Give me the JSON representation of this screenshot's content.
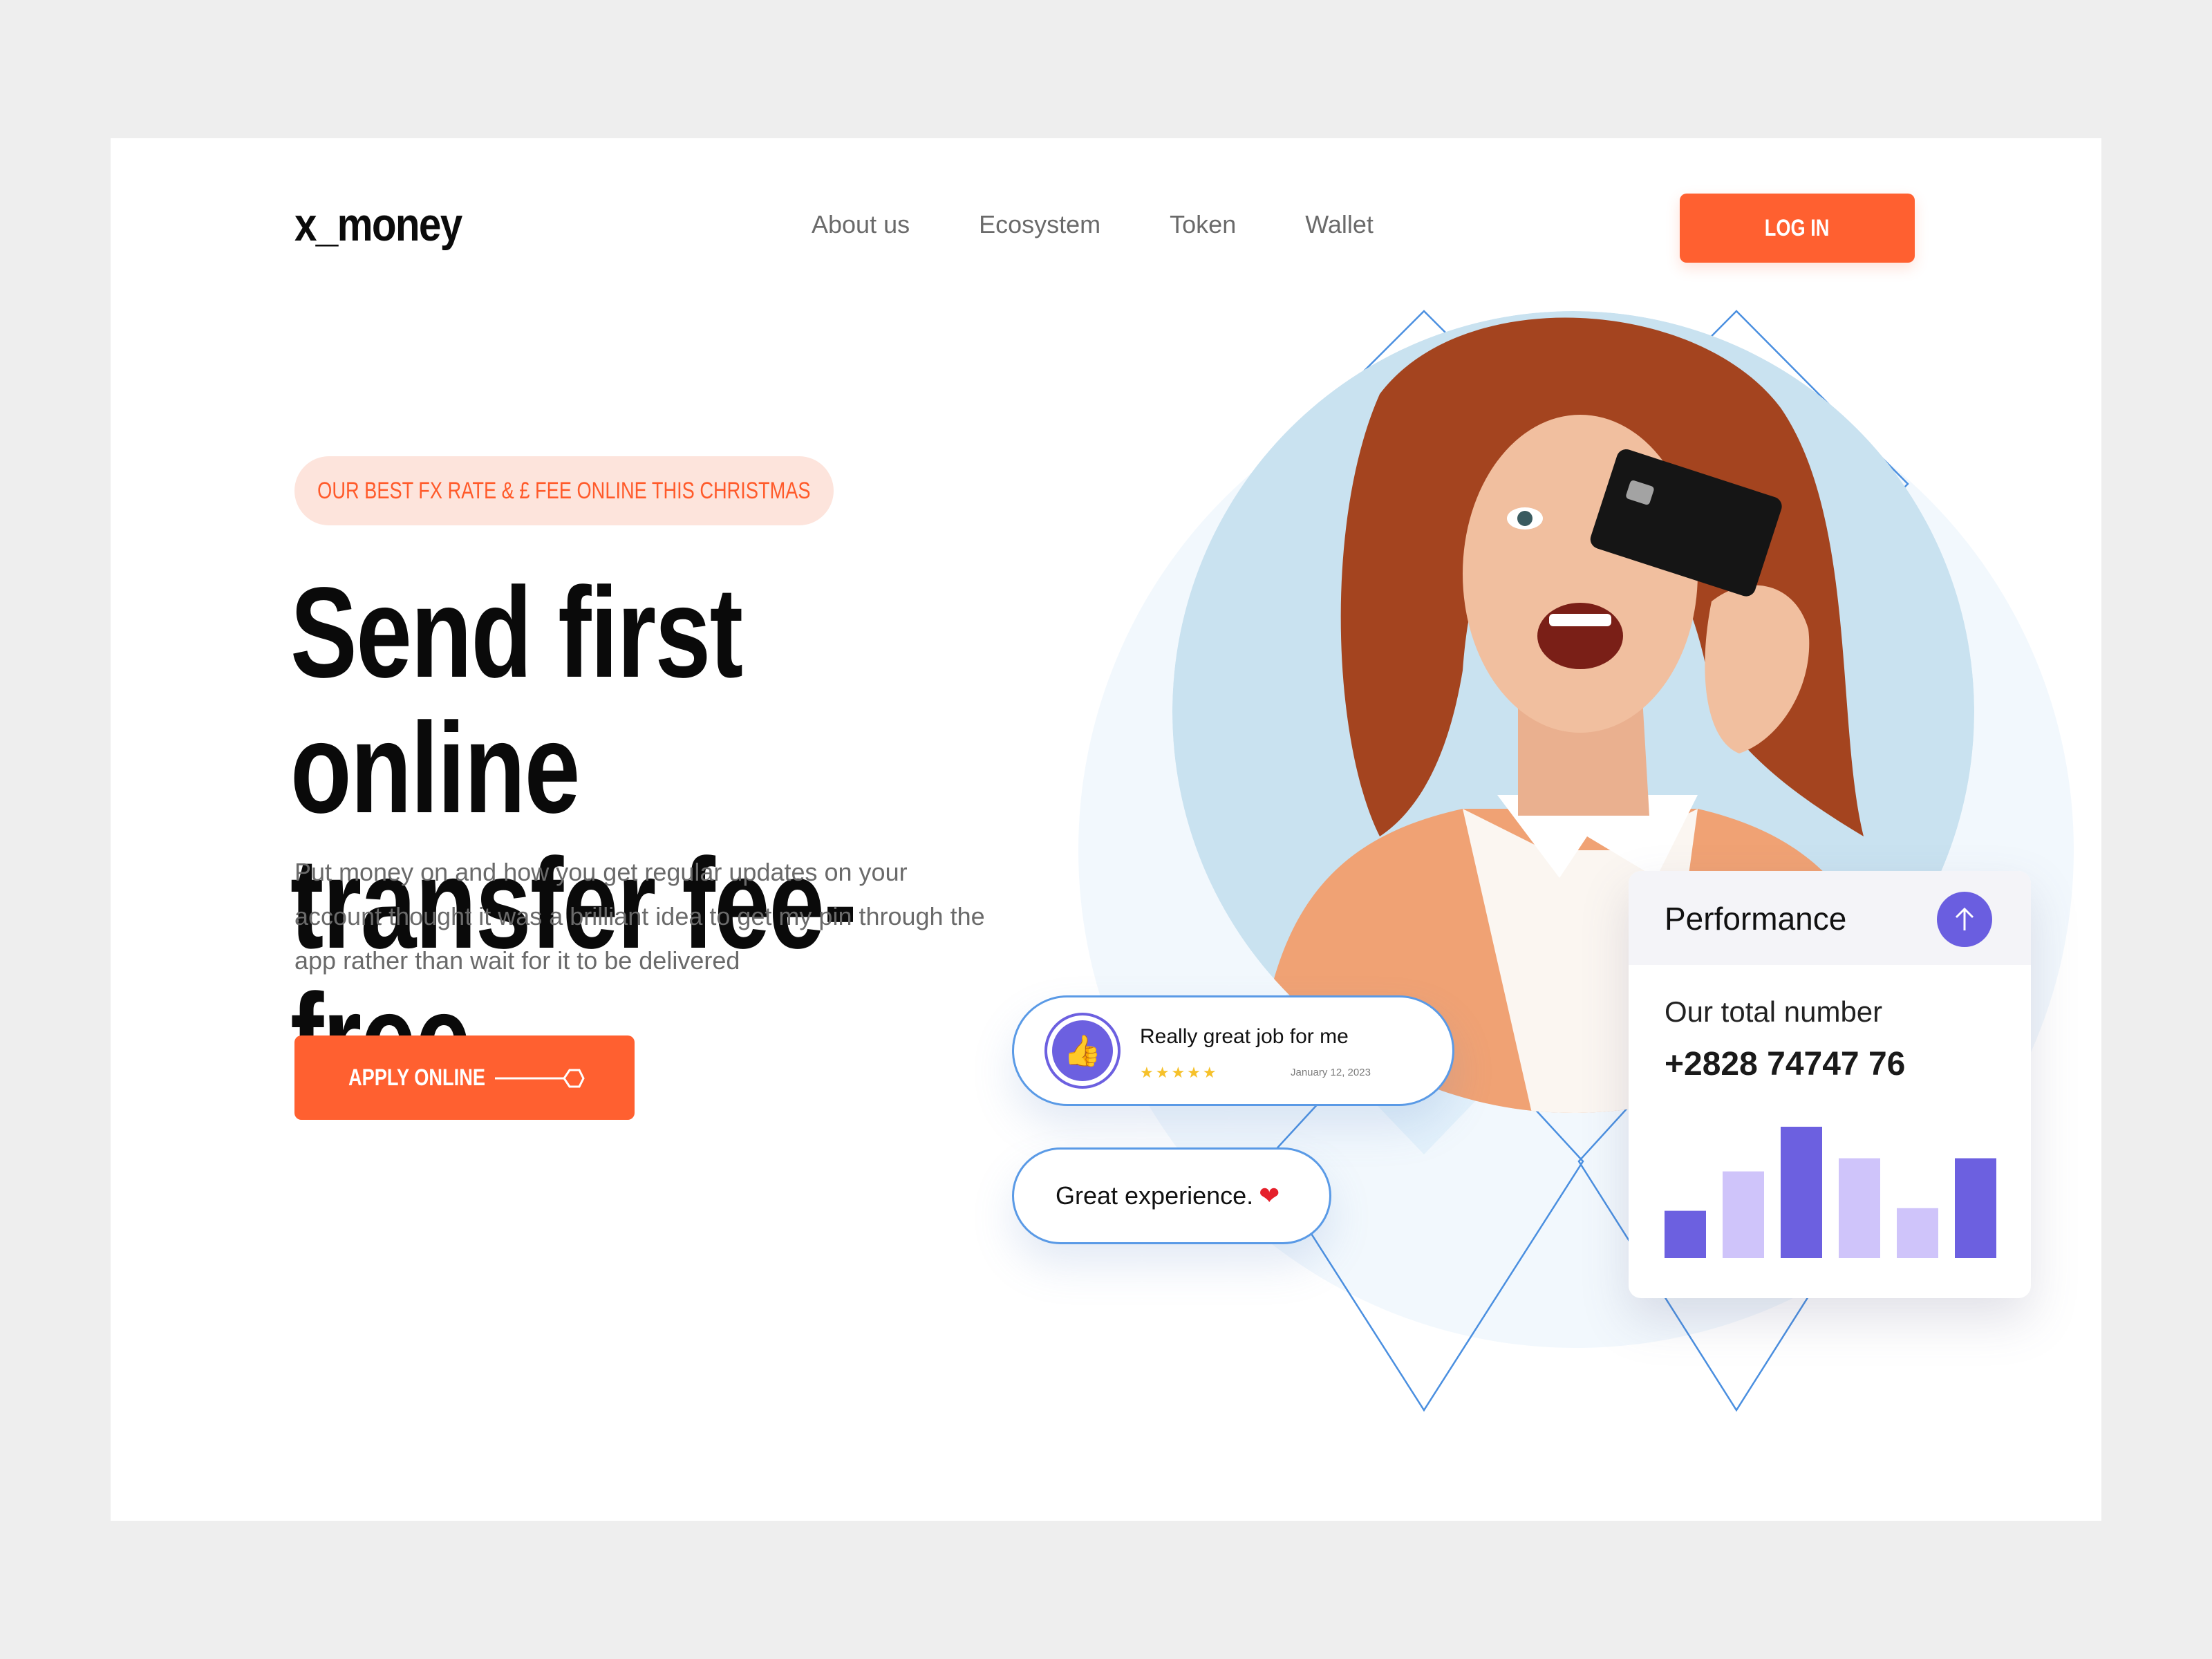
{
  "header": {
    "logo": "x_money",
    "nav": [
      "About us",
      "Ecosystem",
      "Token",
      "Wallet"
    ],
    "login_label": "LOG IN"
  },
  "hero": {
    "promo": "OUR BEST FX RATE & £ FEE ONLINE THIS CHRISTMAS",
    "headline_line1": "Send first online",
    "headline_line2": "transfer fee-free",
    "subtext": "Put money on and how you get regular updates on your account thought it was a brilliant idea to get my pin through the app rather than wait for it to be delivered",
    "apply_label": "APPLY ONLINE"
  },
  "review_card": {
    "text": "Really great job for me",
    "stars": "★★★★★",
    "rating": 5,
    "date": "January 12, 2023"
  },
  "experience_card": {
    "text": "Great experience.",
    "heart": "❤"
  },
  "performance": {
    "title": "Performance",
    "label": "Our total number",
    "number": "+2828 74747 76",
    "bar_levels": [
      0.36,
      0.66,
      1.0,
      0.76,
      0.38,
      0.76
    ],
    "bar_colors": [
      "#6c60e0",
      "#cfc4fa",
      "#6c60e0",
      "#cfc4fa",
      "#cfc4fa",
      "#6c60e0"
    ]
  },
  "colors": {
    "accent": "#ff6030",
    "promo_bg": "#fde4dc",
    "purple": "#6c60e0",
    "light_purple": "#cfc4fa",
    "outline_blue": "#5a9ae6"
  }
}
